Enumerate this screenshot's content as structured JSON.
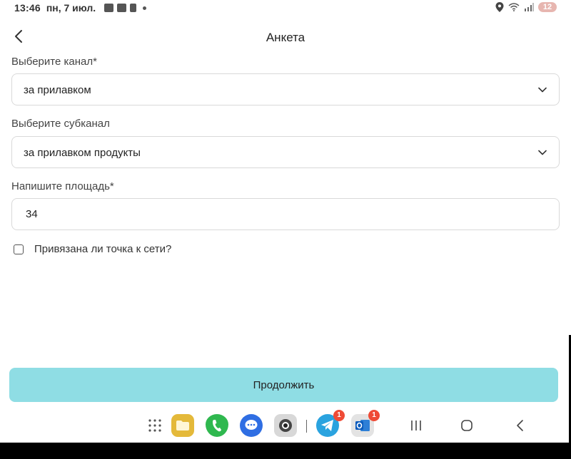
{
  "status_bar": {
    "time": "13:46",
    "date": "пн, 7 июл.",
    "battery": "12"
  },
  "header": {
    "title": "Анкета"
  },
  "form": {
    "channel": {
      "label": "Выберите канал*",
      "value": "за прилавком"
    },
    "subchannel": {
      "label": "Выберите субканал",
      "value": "за прилавком продукты"
    },
    "area": {
      "label": "Напишите площадь*",
      "value": "34"
    },
    "network": {
      "label": "Привязана ли точка к сети?",
      "checked": false
    }
  },
  "actions": {
    "continue_label": "Продолжить"
  },
  "dock": {
    "apps": [
      {
        "name": "app-drawer-icon"
      },
      {
        "name": "files-app-icon"
      },
      {
        "name": "phone-app-icon"
      },
      {
        "name": "messages-app-icon"
      },
      {
        "name": "camera-app-icon"
      },
      {
        "name": "telegram-app-icon",
        "badge": "1"
      },
      {
        "name": "outlook-app-icon",
        "badge": "1"
      }
    ]
  },
  "colors": {
    "accent": "#8fdde4",
    "badge": "#ef4b36"
  }
}
